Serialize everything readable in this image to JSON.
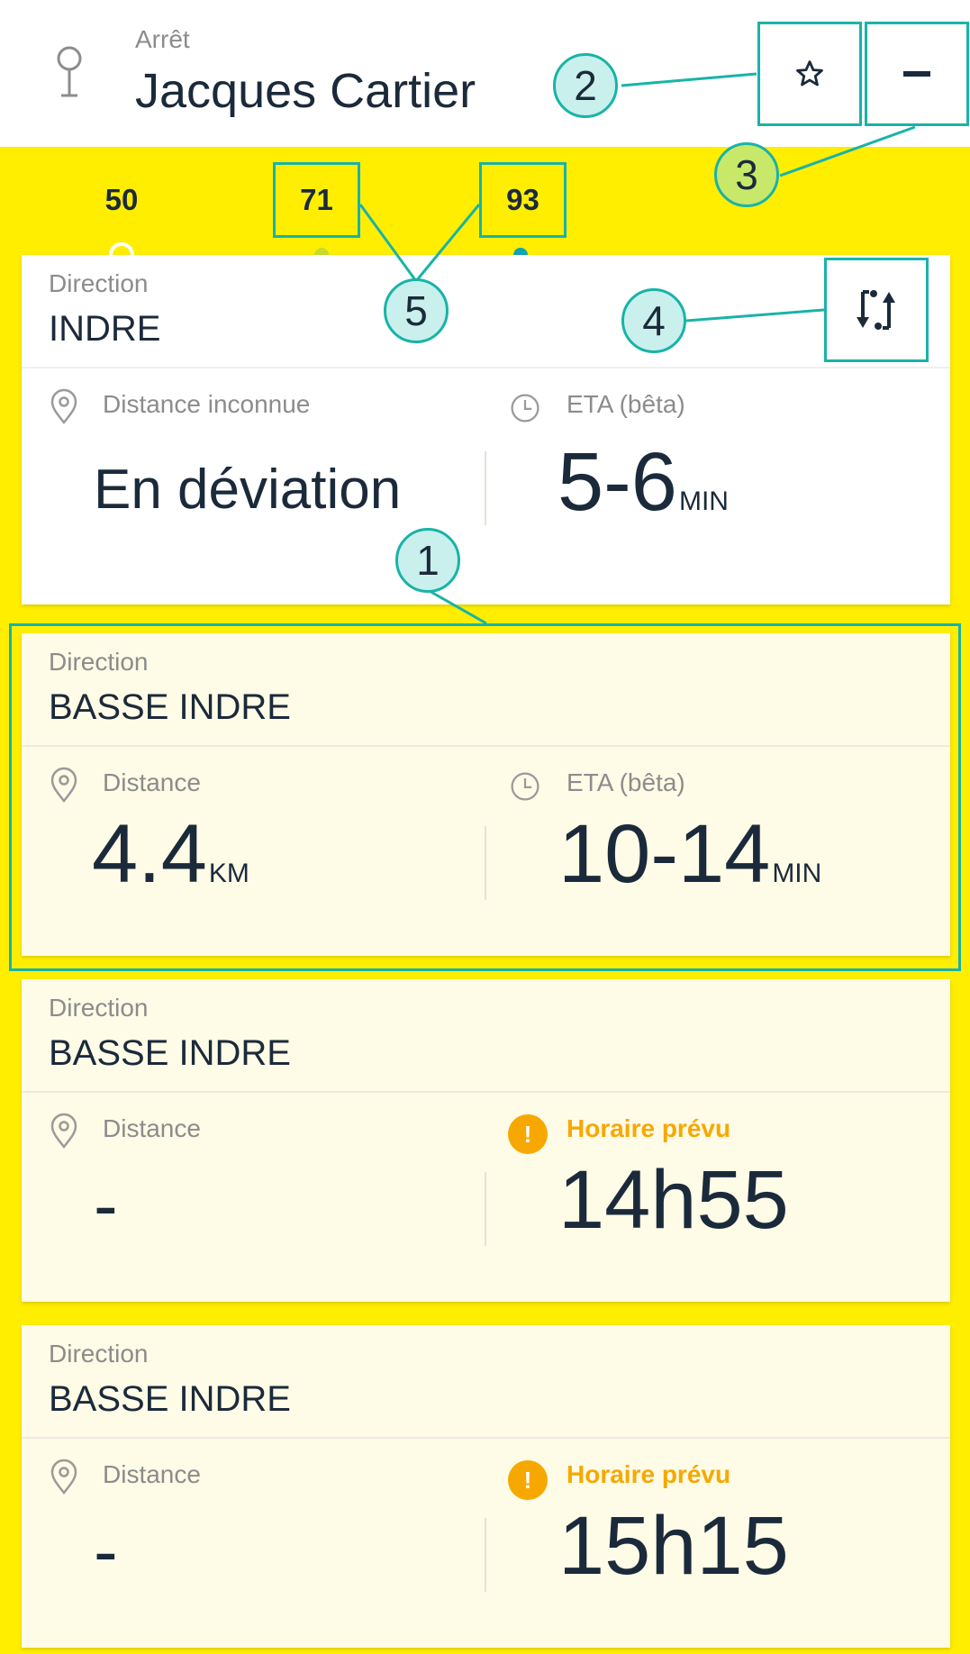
{
  "header": {
    "stop_label": "Arrêt",
    "stop_name": "Jacques Cartier",
    "pin_icon": "map-pin-icon",
    "favorite_icon": "star-outline-icon",
    "collapse_icon": "minus-icon"
  },
  "tabs": [
    {
      "label": "50",
      "dot_color": "#ffee00",
      "selected": true
    },
    {
      "label": "71",
      "dot_color": "#c6de2a",
      "selected": false
    },
    {
      "label": "93",
      "dot_color": "#10a3b4",
      "selected": false
    }
  ],
  "swap_icon": "swap-direction-icon",
  "cards": [
    {
      "direction_label": "Direction",
      "direction_name": "INDRE",
      "distance_label": "Distance inconnue",
      "distance_value": "En déviation",
      "distance_unit": "",
      "time_label": "ETA (bêta)",
      "time_value": "5-6",
      "time_unit": "MIN"
    },
    {
      "direction_label": "Direction",
      "direction_name": "BASSE INDRE",
      "distance_label": "Distance",
      "distance_value": "4.4",
      "distance_unit": "KM",
      "time_label": "ETA (bêta)",
      "time_value": "10-14",
      "time_unit": "MIN"
    },
    {
      "direction_label": "Direction",
      "direction_name": "BASSE INDRE",
      "distance_label": "Distance",
      "distance_value": "-",
      "time_label": "Horaire prévu",
      "time_value": "14h55"
    },
    {
      "direction_label": "Direction",
      "direction_name": "BASSE INDRE",
      "distance_label": "Distance",
      "distance_value": "-",
      "time_label": "Horaire prévu",
      "time_value": "15h15"
    }
  ],
  "annotations": [
    "1",
    "2",
    "3",
    "4",
    "5"
  ],
  "colors": {
    "accent_yellow": "#ffee00",
    "annotation_teal": "#19b3a8",
    "warning_orange": "#f7a800",
    "text_dark": "#1b2a3b"
  }
}
